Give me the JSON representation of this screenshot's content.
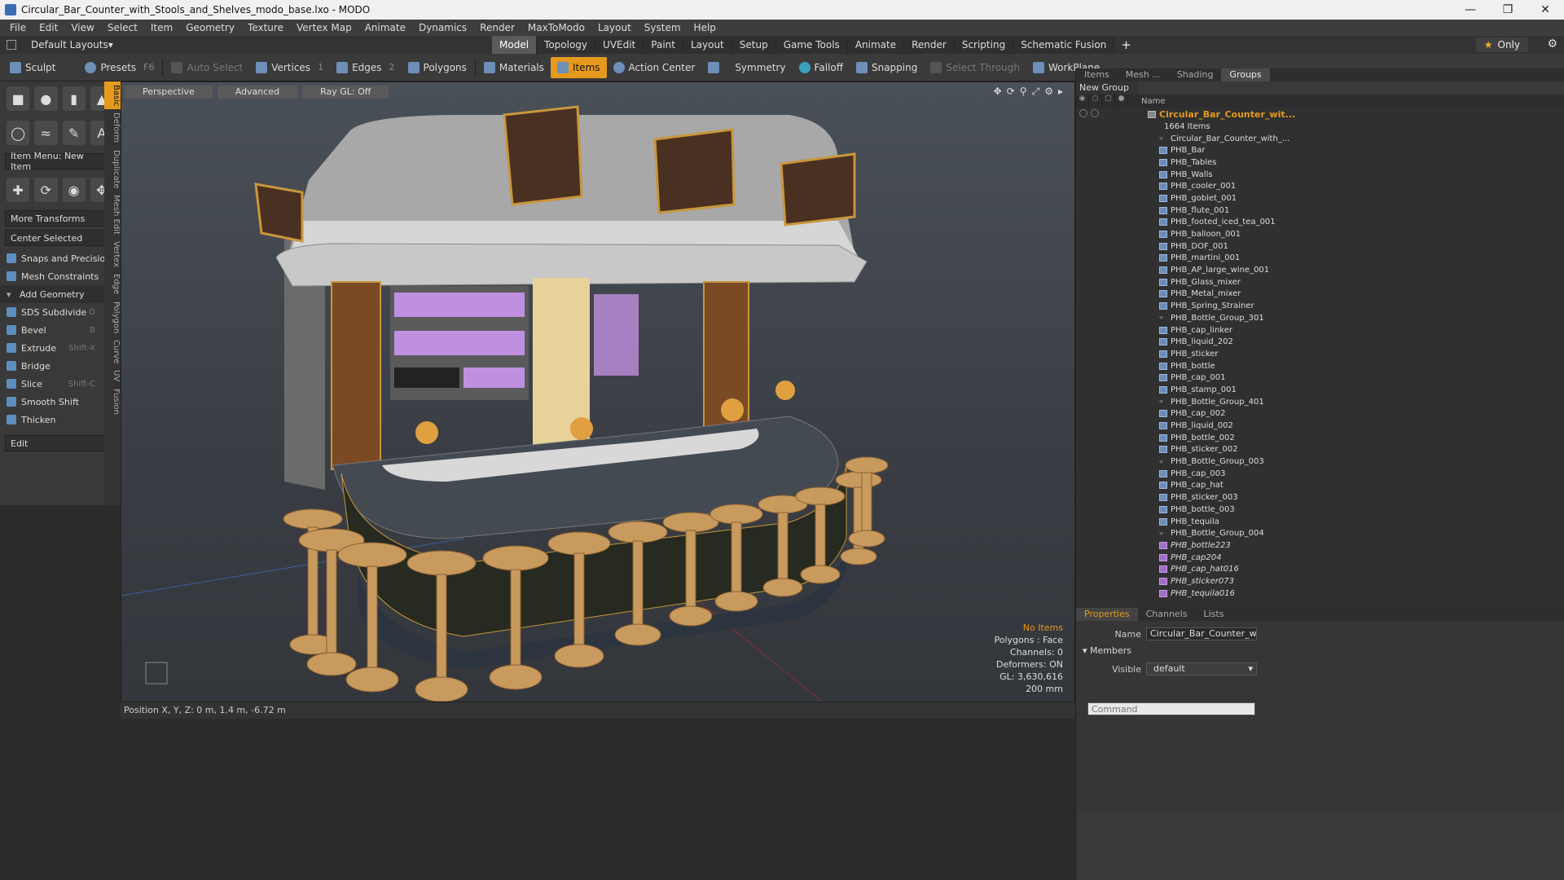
{
  "window": {
    "title": "Circular_Bar_Counter_with_Stools_and_Shelves_modo_base.lxo - MODO"
  },
  "menu": [
    "File",
    "Edit",
    "View",
    "Select",
    "Item",
    "Geometry",
    "Texture",
    "Vertex Map",
    "Animate",
    "Dynamics",
    "Render",
    "MaxToModo",
    "Layout",
    "System",
    "Help"
  ],
  "layouts_label": "Default Layouts",
  "tabs": [
    "Model",
    "Topology",
    "UVEdit",
    "Paint",
    "Layout",
    "Setup",
    "Game Tools",
    "Animate",
    "Render",
    "Scripting",
    "Schematic Fusion"
  ],
  "only_label": "Only",
  "toolbar": {
    "sculpt": "Sculpt",
    "presets": "Presets",
    "presets_key": "F6",
    "auto_select": "Auto Select",
    "vertices": "Vertices",
    "vertices_count": "1",
    "edges": "Edges",
    "edges_count": "2",
    "polygons": "Polygons",
    "materials": "Materials",
    "items": "Items",
    "action_center": "Action Center",
    "symmetry": "Symmetry",
    "falloff": "Falloff",
    "snapping": "Snapping",
    "select_through": "Select Through",
    "workplane": "WorkPlane"
  },
  "leftpanel": {
    "item_menu": "Item Menu: New Item",
    "more_transforms": "More Transforms",
    "center_selected": "Center Selected",
    "snaps": "Snaps and Precision",
    "mesh_constraints": "Mesh Constraints",
    "add_geometry": "Add Geometry",
    "sds": "SDS Subdivide",
    "sds_key": "D",
    "bevel": "Bevel",
    "bevel_key": "B",
    "extrude": "Extrude",
    "extrude_key": "Shift-X",
    "bridge": "Bridge",
    "slice": "Slice",
    "slice_key": "Shift-C",
    "smooth_shift": "Smooth Shift",
    "thicken": "Thicken",
    "edit": "Edit",
    "vtabs": [
      "Basic",
      "Deform",
      "Duplicate",
      "Mesh Edit",
      "Vertex",
      "Edge",
      "Polygon",
      "Curve",
      "UV",
      "Fusion"
    ]
  },
  "viewport": {
    "perspective": "Perspective",
    "advanced": "Advanced",
    "raygl": "Ray GL: Off",
    "info": {
      "no_items": "No Items",
      "polygons": "Polygons : Face",
      "channels": "Channels: 0",
      "deformers": "Deformers: ON",
      "gl": "GL: 3,630,616",
      "scale": "200 mm"
    }
  },
  "statusbar": "Position X, Y, Z:  0 m, 1.4 m, -6.72 m",
  "rightpanel": {
    "tabs": [
      "Items",
      "Mesh ...",
      "Shading",
      "Groups"
    ],
    "new_group": "New Group",
    "name_col": "Name",
    "root": "Circular_Bar_Counter_wit...",
    "count": "1664 Items",
    "items": [
      {
        "name": "Circular_Bar_Counter_with_...",
        "type": "grp"
      },
      {
        "name": "PHB_Bar",
        "type": "mesh"
      },
      {
        "name": "PHB_Tables",
        "type": "mesh"
      },
      {
        "name": "PHB_Walls",
        "type": "mesh"
      },
      {
        "name": "PHB_cooler_001",
        "type": "mesh"
      },
      {
        "name": "PHB_goblet_001",
        "type": "mesh"
      },
      {
        "name": "PHB_flute_001",
        "type": "mesh"
      },
      {
        "name": "PHB_footed_iced_tea_001",
        "type": "mesh"
      },
      {
        "name": "PHB_balloon_001",
        "type": "mesh"
      },
      {
        "name": "PHB_DOF_001",
        "type": "mesh"
      },
      {
        "name": "PHB_martini_001",
        "type": "mesh"
      },
      {
        "name": "PHB_AP_large_wine_001",
        "type": "mesh"
      },
      {
        "name": "PHB_Glass_mixer",
        "type": "mesh"
      },
      {
        "name": "PHB_Metal_mixer",
        "type": "mesh"
      },
      {
        "name": "PHB_Spring_Strainer",
        "type": "mesh"
      },
      {
        "name": "PHB_Bottle_Group_301",
        "type": "grp"
      },
      {
        "name": "PHB_cap_linker",
        "type": "mesh"
      },
      {
        "name": "PHB_liquid_202",
        "type": "mesh"
      },
      {
        "name": "PHB_sticker",
        "type": "mesh"
      },
      {
        "name": "PHB_bottle",
        "type": "mesh"
      },
      {
        "name": "PHB_cap_001",
        "type": "mesh"
      },
      {
        "name": "PHB_stamp_001",
        "type": "mesh"
      },
      {
        "name": "PHB_Bottle_Group_401",
        "type": "grp"
      },
      {
        "name": "PHB_cap_002",
        "type": "mesh"
      },
      {
        "name": "PHB_liquid_002",
        "type": "mesh"
      },
      {
        "name": "PHB_bottle_002",
        "type": "mesh"
      },
      {
        "name": "PHB_sticker_002",
        "type": "mesh"
      },
      {
        "name": "PHB_Bottle_Group_003",
        "type": "grp"
      },
      {
        "name": "PHB_cap_003",
        "type": "mesh"
      },
      {
        "name": "PHB_cap_hat",
        "type": "mesh"
      },
      {
        "name": "PHB_sticker_003",
        "type": "mesh"
      },
      {
        "name": "PHB_bottle_003",
        "type": "mesh"
      },
      {
        "name": "PHB_tequila",
        "type": "mesh"
      },
      {
        "name": "PHB_Bottle_Group_004",
        "type": "grp"
      },
      {
        "name": "PHB_bottle223",
        "type": "inst"
      },
      {
        "name": "PHB_cap204",
        "type": "inst"
      },
      {
        "name": "PHB_cap_hat016",
        "type": "inst"
      },
      {
        "name": "PHB_sticker073",
        "type": "inst"
      },
      {
        "name": "PHB_tequila016",
        "type": "inst"
      }
    ],
    "props_tabs": [
      "Properties",
      "Channels",
      "Lists"
    ],
    "name_label": "Name",
    "name_value": "Circular_Bar_Counter_with_Stool",
    "members": "Members",
    "visible_label": "Visible",
    "visible_value": "default",
    "command_placeholder": "Command"
  }
}
